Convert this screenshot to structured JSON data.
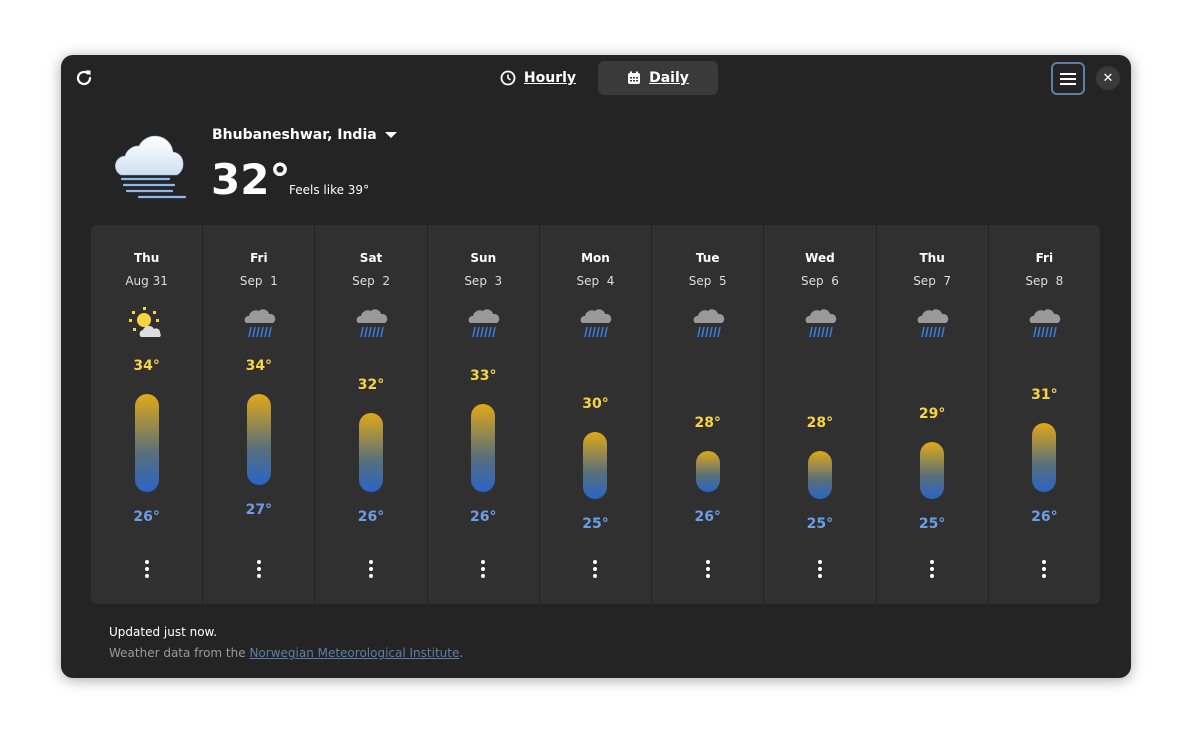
{
  "header": {
    "tabs": [
      {
        "label": "Hourly",
        "icon": "clock-icon"
      },
      {
        "label": "Daily",
        "icon": "calendar-icon",
        "active": true
      }
    ]
  },
  "location": "Bhubaneshwar, India",
  "current": {
    "temp": "32°",
    "feels_like": "Feels like 39°",
    "icon": "fog-cloud-icon"
  },
  "colors": {
    "high": "#f8d440",
    "low": "#6a9ee8",
    "link": "#5a7fa8",
    "accent_bar_top": "#e0a818",
    "accent_bar_bottom": "#2a64c8"
  },
  "days": [
    {
      "day": "Thu",
      "date": "Aug 31",
      "icon": "partly-sunny-icon",
      "high": "34°",
      "low": "26°",
      "hi": 34,
      "lo": 26
    },
    {
      "day": "Fri",
      "date": "Sep  1",
      "icon": "rain-icon",
      "high": "34°",
      "low": "27°",
      "hi": 34,
      "lo": 27
    },
    {
      "day": "Sat",
      "date": "Sep  2",
      "icon": "rain-icon",
      "high": "32°",
      "low": "26°",
      "hi": 32,
      "lo": 26
    },
    {
      "day": "Sun",
      "date": "Sep  3",
      "icon": "rain-icon",
      "high": "33°",
      "low": "26°",
      "hi": 33,
      "lo": 26
    },
    {
      "day": "Mon",
      "date": "Sep  4",
      "icon": "rain-icon",
      "high": "30°",
      "low": "25°",
      "hi": 30,
      "lo": 25
    },
    {
      "day": "Tue",
      "date": "Sep  5",
      "icon": "rain-icon",
      "high": "28°",
      "low": "26°",
      "hi": 28,
      "lo": 26
    },
    {
      "day": "Wed",
      "date": "Sep  6",
      "icon": "rain-icon",
      "high": "28°",
      "low": "25°",
      "hi": 28,
      "lo": 25
    },
    {
      "day": "Thu",
      "date": "Sep  7",
      "icon": "rain-icon",
      "high": "29°",
      "low": "25°",
      "hi": 29,
      "lo": 25
    },
    {
      "day": "Fri",
      "date": "Sep  8",
      "icon": "rain-icon",
      "high": "31°",
      "low": "26°",
      "hi": 31,
      "lo": 26
    }
  ],
  "footer": {
    "updated": "Updated just now.",
    "source_prefix": "Weather data from the ",
    "source_link": "Norwegian Meteorological Institute",
    "source_suffix": "."
  }
}
